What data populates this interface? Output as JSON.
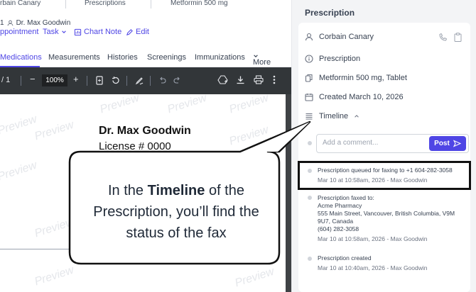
{
  "breadcrumb": {
    "items": [
      "rbain Canary",
      "Prescriptions",
      "Metformin 500 mg"
    ]
  },
  "patient_header": {
    "prefix": "1",
    "provider": "Dr. Max Goodwin"
  },
  "actions": {
    "appointment": "ppointment",
    "task": "Task",
    "chart_note": "Chart Note",
    "edit": "Edit"
  },
  "tabs": [
    "Medications",
    "Measurements",
    "Histories",
    "Screenings",
    "Immunizations",
    "More"
  ],
  "pdf_toolbar": {
    "page": "/ 1",
    "zoom": "100%"
  },
  "document": {
    "name": "Dr. Max Goodwin",
    "license": "License # 0000",
    "watermark": "Preview"
  },
  "panel": {
    "title": "Prescription",
    "patient": "Corbain Canary",
    "type": "Prescription",
    "medication": "Metformin 500 mg, Tablet",
    "created": "Created March 10, 2026",
    "timeline_label": "Timeline",
    "comment_placeholder": "Add a comment...",
    "post_label": "Post"
  },
  "timeline": [
    {
      "title": "Prescription queued for faxing to +1 604-282-3058",
      "time": "Mar 10 at 10:58am, 2026 - Max Goodwin"
    },
    {
      "title": "Prescription faxed to:",
      "lines": [
        "Acme Pharmacy",
        "555 Main Street, Vancouver, British Columbia, V9M",
        "9U7, Canada",
        "(604) 282-3058"
      ],
      "time": "Mar 10 at 10:58am, 2026 - Max Goodwin"
    },
    {
      "title": "Prescription created",
      "time": "Mar 10 at 10:40am, 2026 - Max Goodwin"
    }
  ],
  "callout": {
    "before": "In the ",
    "bold": "Timeline",
    "after": " of the Prescription, you’ll find the status of the fax"
  },
  "colors": {
    "accent": "#4f46e5",
    "toolbar": "#323639",
    "panel_bg": "#f3f4f6"
  }
}
